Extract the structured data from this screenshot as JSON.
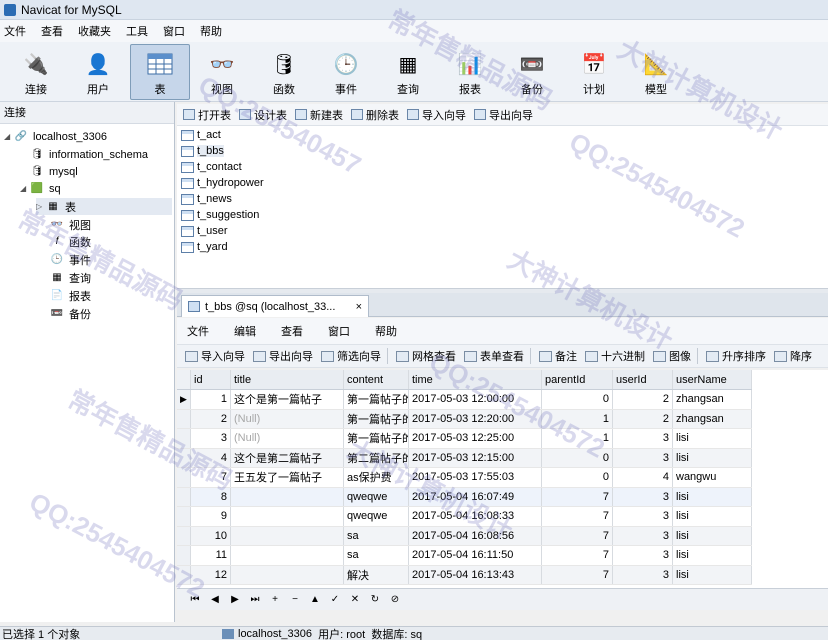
{
  "window": {
    "title": "Navicat for MySQL"
  },
  "menubar": [
    "文件",
    "查看",
    "收藏夹",
    "工具",
    "窗口",
    "帮助"
  ],
  "toolbar": [
    {
      "label": "连接",
      "icon": "connection-icon"
    },
    {
      "label": "用户",
      "icon": "user-icon"
    },
    {
      "label": "表",
      "icon": "table-icon",
      "active": true
    },
    {
      "label": "视图",
      "icon": "view-icon"
    },
    {
      "label": "函数",
      "icon": "function-icon"
    },
    {
      "label": "事件",
      "icon": "event-icon"
    },
    {
      "label": "查询",
      "icon": "query-icon"
    },
    {
      "label": "报表",
      "icon": "report-icon"
    },
    {
      "label": "备份",
      "icon": "backup-icon"
    },
    {
      "label": "计划",
      "icon": "schedule-icon"
    },
    {
      "label": "模型",
      "icon": "model-icon"
    }
  ],
  "sidebar": {
    "header": "连接",
    "connection": "localhost_3306",
    "databases": [
      "information_schema",
      "mysql",
      "sq"
    ],
    "sq_children": [
      "表",
      "视图",
      "函数",
      "事件",
      "查询",
      "报表",
      "备份"
    ]
  },
  "object_toolbar": [
    "打开表",
    "设计表",
    "新建表",
    "删除表",
    "导入向导",
    "导出向导"
  ],
  "tables": [
    "t_act",
    "t_bbs",
    "t_contact",
    "t_hydropower",
    "t_news",
    "t_suggestion",
    "t_user",
    "t_yard"
  ],
  "editor": {
    "tab_title": "t_bbs @sq (localhost_33...",
    "tab_close": "×",
    "menu": [
      "文件",
      "编辑",
      "查看",
      "窗口",
      "帮助"
    ],
    "toolbar": [
      "导入向导",
      "导出向导",
      "筛选向导",
      "网格查看",
      "表单查看",
      "备注",
      "十六进制",
      "图像",
      "升序排序",
      "降序"
    ],
    "columns": [
      "id",
      "title",
      "content",
      "time",
      "parentId",
      "userId",
      "userName"
    ],
    "rows": [
      [
        "1",
        "这个是第一篇帖子",
        "第一篇帖子的",
        "2017-05-03 12:00:00",
        "0",
        "2",
        "zhangsan"
      ],
      [
        "2",
        "(Null)",
        "第一篇帖子的",
        "2017-05-03 12:20:00",
        "1",
        "2",
        "zhangsan"
      ],
      [
        "3",
        "(Null)",
        "第一篇帖子的",
        "2017-05-03 12:25:00",
        "1",
        "3",
        "lisi"
      ],
      [
        "4",
        "这个是第二篇帖子",
        "第二篇帖子的",
        "2017-05-03 12:15:00",
        "0",
        "3",
        "lisi"
      ],
      [
        "7",
        "王五发了一篇帖子",
        "as保护费",
        "2017-05-03 17:55:03",
        "0",
        "4",
        "wangwu"
      ],
      [
        "8",
        "",
        "qweqwe",
        "2017-05-04 16:07:49",
        "7",
        "3",
        "lisi"
      ],
      [
        "9",
        "",
        "qweqwe",
        "2017-05-04 16:08:33",
        "7",
        "3",
        "lisi"
      ],
      [
        "10",
        "",
        "sa",
        "2017-05-04 16:08:56",
        "7",
        "3",
        "lisi"
      ],
      [
        "11",
        "",
        "sa",
        "2017-05-04 16:11:50",
        "7",
        "3",
        "lisi"
      ],
      [
        "12",
        "",
        "解决",
        "2017-05-04 16:13:43",
        "7",
        "3",
        "lisi"
      ]
    ]
  },
  "navigator": [
    "⏮",
    "◀",
    "▶",
    "⏭",
    "+",
    "−",
    "▲",
    "✓",
    "✕",
    "↻",
    "⊘"
  ],
  "status": {
    "left": "已选择 1 个对象",
    "connection": "localhost_3306",
    "user": "用户: root",
    "database": "数据库: sq"
  },
  "watermarks": [
    "常年售精品源码",
    "大神计算机设计",
    "QQ:2545404572",
    "QQ:254540457",
    "常年售精品源码",
    "大神计算机设计",
    "QQ:2545404572",
    "常年售精品源码",
    "大神计算机设计",
    "QQ:2545404572"
  ]
}
